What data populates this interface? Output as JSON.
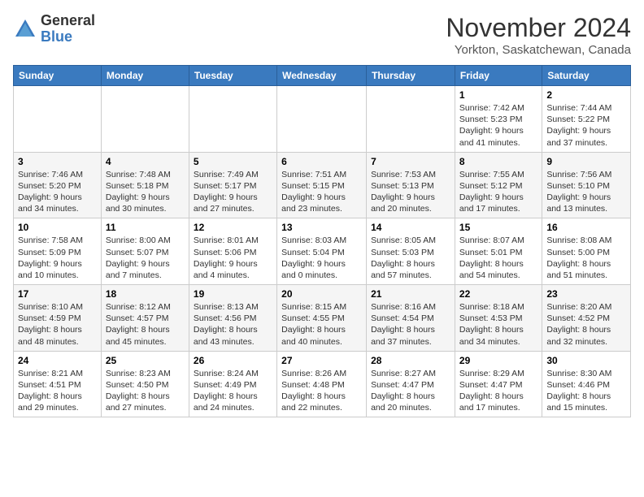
{
  "logo": {
    "general": "General",
    "blue": "Blue"
  },
  "title": "November 2024",
  "location": "Yorkton, Saskatchewan, Canada",
  "days_of_week": [
    "Sunday",
    "Monday",
    "Tuesday",
    "Wednesday",
    "Thursday",
    "Friday",
    "Saturday"
  ],
  "weeks": [
    [
      {
        "day": "",
        "info": ""
      },
      {
        "day": "",
        "info": ""
      },
      {
        "day": "",
        "info": ""
      },
      {
        "day": "",
        "info": ""
      },
      {
        "day": "",
        "info": ""
      },
      {
        "day": "1",
        "info": "Sunrise: 7:42 AM\nSunset: 5:23 PM\nDaylight: 9 hours and 41 minutes."
      },
      {
        "day": "2",
        "info": "Sunrise: 7:44 AM\nSunset: 5:22 PM\nDaylight: 9 hours and 37 minutes."
      }
    ],
    [
      {
        "day": "3",
        "info": "Sunrise: 7:46 AM\nSunset: 5:20 PM\nDaylight: 9 hours and 34 minutes."
      },
      {
        "day": "4",
        "info": "Sunrise: 7:48 AM\nSunset: 5:18 PM\nDaylight: 9 hours and 30 minutes."
      },
      {
        "day": "5",
        "info": "Sunrise: 7:49 AM\nSunset: 5:17 PM\nDaylight: 9 hours and 27 minutes."
      },
      {
        "day": "6",
        "info": "Sunrise: 7:51 AM\nSunset: 5:15 PM\nDaylight: 9 hours and 23 minutes."
      },
      {
        "day": "7",
        "info": "Sunrise: 7:53 AM\nSunset: 5:13 PM\nDaylight: 9 hours and 20 minutes."
      },
      {
        "day": "8",
        "info": "Sunrise: 7:55 AM\nSunset: 5:12 PM\nDaylight: 9 hours and 17 minutes."
      },
      {
        "day": "9",
        "info": "Sunrise: 7:56 AM\nSunset: 5:10 PM\nDaylight: 9 hours and 13 minutes."
      }
    ],
    [
      {
        "day": "10",
        "info": "Sunrise: 7:58 AM\nSunset: 5:09 PM\nDaylight: 9 hours and 10 minutes."
      },
      {
        "day": "11",
        "info": "Sunrise: 8:00 AM\nSunset: 5:07 PM\nDaylight: 9 hours and 7 minutes."
      },
      {
        "day": "12",
        "info": "Sunrise: 8:01 AM\nSunset: 5:06 PM\nDaylight: 9 hours and 4 minutes."
      },
      {
        "day": "13",
        "info": "Sunrise: 8:03 AM\nSunset: 5:04 PM\nDaylight: 9 hours and 0 minutes."
      },
      {
        "day": "14",
        "info": "Sunrise: 8:05 AM\nSunset: 5:03 PM\nDaylight: 8 hours and 57 minutes."
      },
      {
        "day": "15",
        "info": "Sunrise: 8:07 AM\nSunset: 5:01 PM\nDaylight: 8 hours and 54 minutes."
      },
      {
        "day": "16",
        "info": "Sunrise: 8:08 AM\nSunset: 5:00 PM\nDaylight: 8 hours and 51 minutes."
      }
    ],
    [
      {
        "day": "17",
        "info": "Sunrise: 8:10 AM\nSunset: 4:59 PM\nDaylight: 8 hours and 48 minutes."
      },
      {
        "day": "18",
        "info": "Sunrise: 8:12 AM\nSunset: 4:57 PM\nDaylight: 8 hours and 45 minutes."
      },
      {
        "day": "19",
        "info": "Sunrise: 8:13 AM\nSunset: 4:56 PM\nDaylight: 8 hours and 43 minutes."
      },
      {
        "day": "20",
        "info": "Sunrise: 8:15 AM\nSunset: 4:55 PM\nDaylight: 8 hours and 40 minutes."
      },
      {
        "day": "21",
        "info": "Sunrise: 8:16 AM\nSunset: 4:54 PM\nDaylight: 8 hours and 37 minutes."
      },
      {
        "day": "22",
        "info": "Sunrise: 8:18 AM\nSunset: 4:53 PM\nDaylight: 8 hours and 34 minutes."
      },
      {
        "day": "23",
        "info": "Sunrise: 8:20 AM\nSunset: 4:52 PM\nDaylight: 8 hours and 32 minutes."
      }
    ],
    [
      {
        "day": "24",
        "info": "Sunrise: 8:21 AM\nSunset: 4:51 PM\nDaylight: 8 hours and 29 minutes."
      },
      {
        "day": "25",
        "info": "Sunrise: 8:23 AM\nSunset: 4:50 PM\nDaylight: 8 hours and 27 minutes."
      },
      {
        "day": "26",
        "info": "Sunrise: 8:24 AM\nSunset: 4:49 PM\nDaylight: 8 hours and 24 minutes."
      },
      {
        "day": "27",
        "info": "Sunrise: 8:26 AM\nSunset: 4:48 PM\nDaylight: 8 hours and 22 minutes."
      },
      {
        "day": "28",
        "info": "Sunrise: 8:27 AM\nSunset: 4:47 PM\nDaylight: 8 hours and 20 minutes."
      },
      {
        "day": "29",
        "info": "Sunrise: 8:29 AM\nSunset: 4:47 PM\nDaylight: 8 hours and 17 minutes."
      },
      {
        "day": "30",
        "info": "Sunrise: 8:30 AM\nSunset: 4:46 PM\nDaylight: 8 hours and 15 minutes."
      }
    ]
  ]
}
